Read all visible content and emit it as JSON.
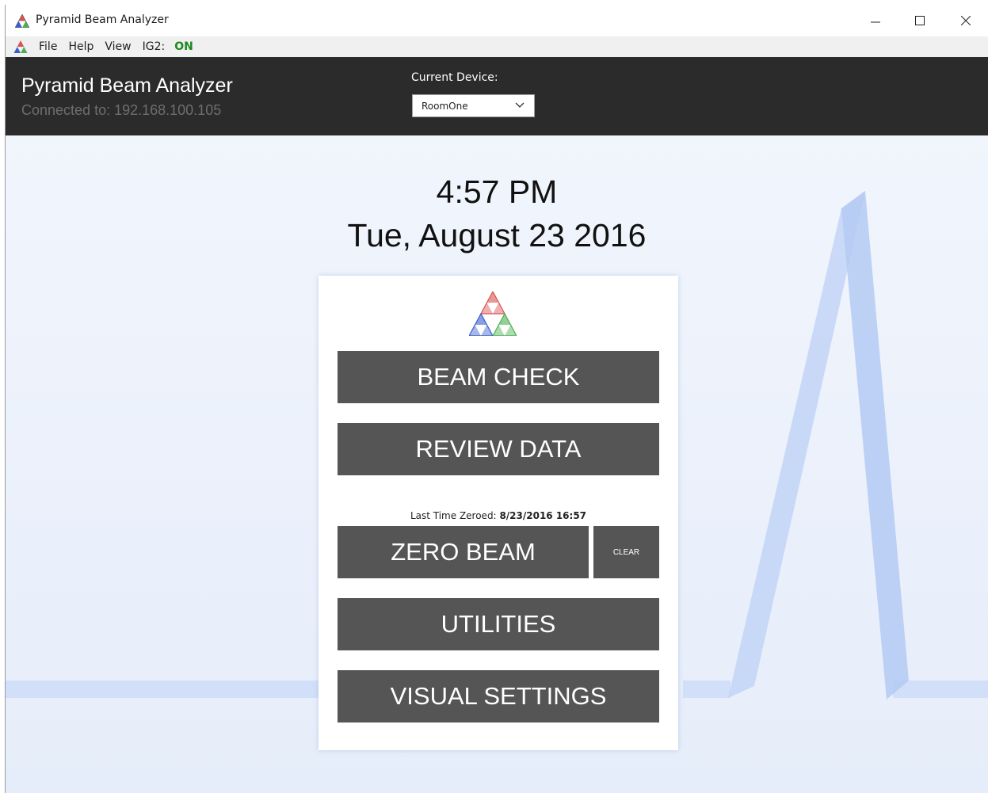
{
  "window": {
    "title": "Pyramid Beam Analyzer"
  },
  "menu": {
    "items": [
      "File",
      "Help",
      "View",
      "IG2:"
    ],
    "ig2_status": "ON",
    "ig2_status_color": "#1e8a1e"
  },
  "header": {
    "app_name": "Pyramid Beam Analyzer",
    "connected": "Connected to: 192.168.100.105",
    "device_label": "Current Device:",
    "device_value": "RoomOne"
  },
  "clock": {
    "time": "4:57 PM",
    "date": "Tue, August 23 2016"
  },
  "panel": {
    "beam_check": "BEAM CHECK",
    "review_data": "REVIEW DATA",
    "last_zeroed_label": "Last Time Zeroed:",
    "last_zeroed_value": "8/23/2016 16:57",
    "zero_beam": "ZERO BEAM",
    "clear": "CLEAR",
    "utilities": "UTILITIES",
    "visual_settings": "VISUAL SETTINGS"
  },
  "colors": {
    "header_bg": "#2b2b2b",
    "button_bg": "#555555",
    "accent_red": "#d9534f",
    "accent_blue": "#3a5fcd",
    "accent_green": "#4caf50"
  }
}
